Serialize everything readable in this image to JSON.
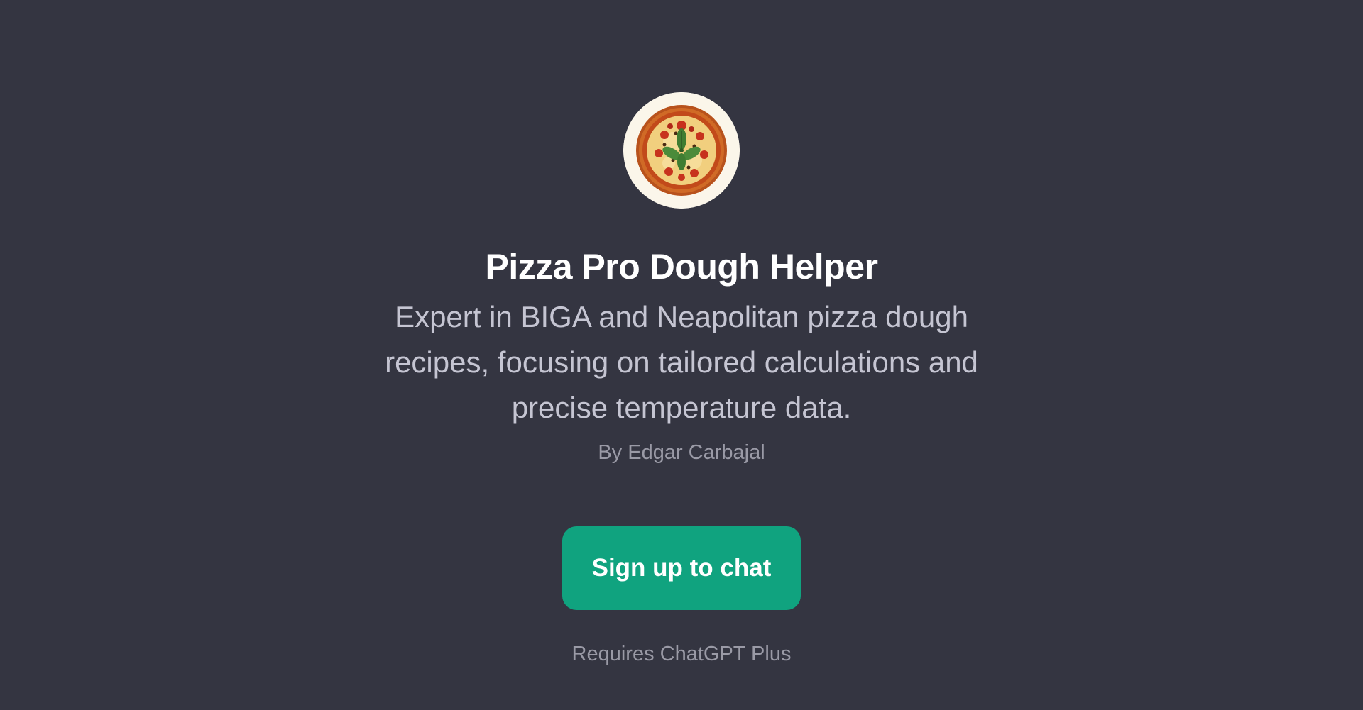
{
  "gpt": {
    "avatar_icon": "pizza-icon",
    "title": "Pizza Pro Dough Helper",
    "description": "Expert in BIGA and Neapolitan pizza dough recipes, focusing on tailored calculations and precise temperature data.",
    "author": "By Edgar Carbajal"
  },
  "cta": {
    "label": "Sign up to chat"
  },
  "footer": {
    "requires": "Requires ChatGPT Plus"
  },
  "colors": {
    "background": "#343541",
    "accent": "#10a37f",
    "title_text": "#ffffff",
    "description_text": "#c5c5d2",
    "muted_text": "#9a9aa6",
    "avatar_background": "#fbf6ea"
  }
}
